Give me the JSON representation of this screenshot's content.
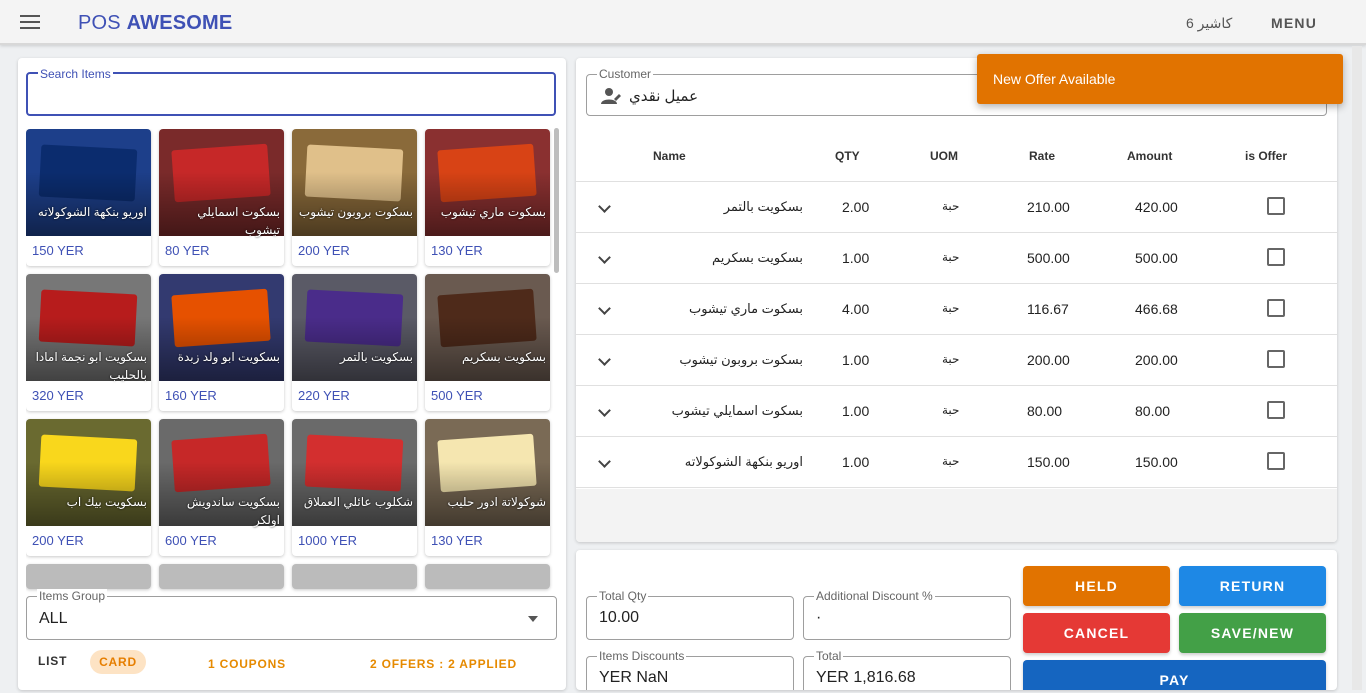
{
  "appbar": {
    "brand_a": "POS ",
    "brand_b": "AWESOME",
    "user": "كاشير 6",
    "menu": "MENU"
  },
  "search": {
    "label": "Search Items",
    "value": "",
    "placeholder": ""
  },
  "items": [
    {
      "name": "اوريو بنكهة الشوكولاته",
      "price": "150 YER",
      "bg": "#1d3f8a",
      "pkg": "#0b2c6e"
    },
    {
      "name": "بسكوت اسمايلي تيشوب",
      "price": "80 YER",
      "bg": "#7a2a2a",
      "pkg": "#c62828"
    },
    {
      "name": "بسكوت بروبون تيشوب",
      "price": "200 YER",
      "bg": "#8a6a3a",
      "pkg": "#e0c08a"
    },
    {
      "name": "بسكوت ماري تيشوب",
      "price": "130 YER",
      "bg": "#8a3030",
      "pkg": "#d84315"
    },
    {
      "name": "بسكويت ابو نجمة امادا بالحليب",
      "price": "320 YER",
      "bg": "#777777",
      "pkg": "#b71c1c"
    },
    {
      "name": "بسكويت ابو ولد زبدة",
      "price": "160 YER",
      "bg": "#333a70",
      "pkg": "#e65100"
    },
    {
      "name": "بسكويت بالتمر",
      "price": "220 YER",
      "bg": "#5a5a66",
      "pkg": "#4a2c8a"
    },
    {
      "name": "بسكويت بسكريم",
      "price": "500 YER",
      "bg": "#6a5a50",
      "pkg": "#4e2a1a"
    },
    {
      "name": "بسكويت بيك اب",
      "price": "200 YER",
      "bg": "#6a6a30",
      "pkg": "#f9d71c"
    },
    {
      "name": "بسكويت ساندويش اولكر",
      "price": "600 YER",
      "bg": "#6a6a6a",
      "pkg": "#c62828"
    },
    {
      "name": "شكلوب عائلي العملاق",
      "price": "1000 YER",
      "bg": "#6a6a6a",
      "pkg": "#d32f2f"
    },
    {
      "name": "شوكولاتة ادور حليب",
      "price": "130 YER",
      "bg": "#7a6a55",
      "pkg": "#f5e6b0"
    }
  ],
  "items_group": {
    "label": "Items Group",
    "value": "ALL"
  },
  "view_toggle": {
    "list": "LIST",
    "card": "CARD"
  },
  "coupons": "1 COUPONS",
  "offers": "2 OFFERS : 2 APPLIED",
  "customer": {
    "label": "Customer",
    "value": "عميل نقدي"
  },
  "table": {
    "headers": [
      "Name",
      "QTY",
      "UOM",
      "Rate",
      "Amount",
      "is Offer"
    ],
    "rows": [
      {
        "name": "بسكويت بالتمر",
        "qty": "2.00",
        "uom": "حبة",
        "rate": "210.00",
        "amount": "420.00"
      },
      {
        "name": "بسكويت بسكريم",
        "qty": "1.00",
        "uom": "حبة",
        "rate": "500.00",
        "amount": "500.00"
      },
      {
        "name": "بسكوت ماري تيشوب",
        "qty": "4.00",
        "uom": "حبة",
        "rate": "116.67",
        "amount": "466.68"
      },
      {
        "name": "بسكوت بروبون تيشوب",
        "qty": "1.00",
        "uom": "حبة",
        "rate": "200.00",
        "amount": "200.00"
      },
      {
        "name": "بسكوت اسمايلي تيشوب",
        "qty": "1.00",
        "uom": "حبة",
        "rate": "80.00",
        "amount": "80.00"
      },
      {
        "name": "اوريو بنكهة الشوكولاته",
        "qty": "1.00",
        "uom": "حبة",
        "rate": "150.00",
        "amount": "150.00"
      }
    ]
  },
  "totals": {
    "total_qty_label": "Total Qty",
    "total_qty": "10.00",
    "add_disc_label": "Additional Discount %",
    "add_disc": "·",
    "items_disc_label": "Items Discounts",
    "items_disc": "YER NaN",
    "total_label": "Total",
    "total": "YER 1,816.68"
  },
  "buttons": {
    "held": "HELD",
    "return": "RETURN",
    "cancel": "CANCEL",
    "save_new": "SAVE/NEW",
    "pay": "PAY"
  },
  "toast": "New Offer Available",
  "colors": {
    "primary": "#3f51b5",
    "orange": "#e17300",
    "blue": "#1e88e5",
    "red": "#e53935",
    "green": "#43a047"
  }
}
